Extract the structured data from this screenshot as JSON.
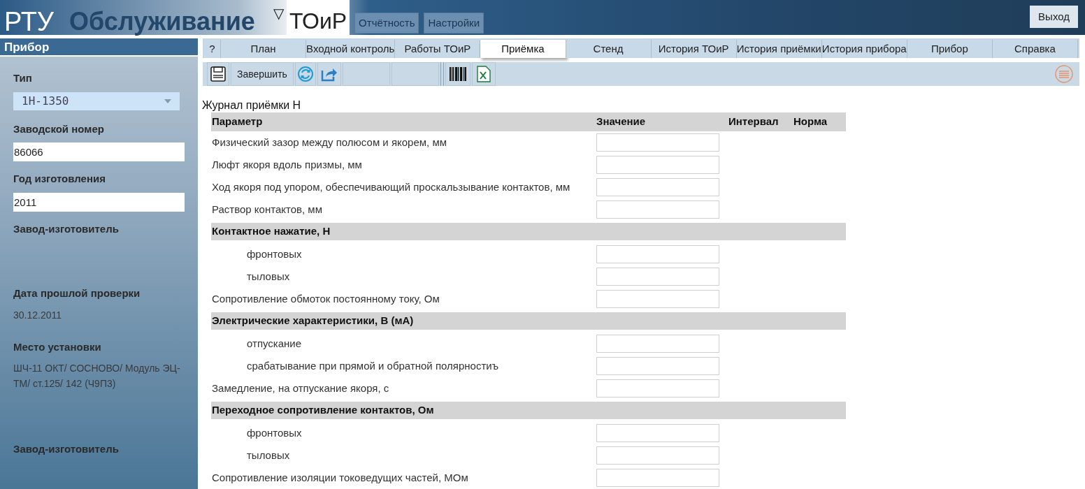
{
  "header": {
    "brand": "РТУ",
    "title": "Обслуживание",
    "module_caret": "▽",
    "module": "ТОиР",
    "menu": [
      {
        "label": "Отчётность"
      },
      {
        "label": "Настройки"
      }
    ],
    "logout": "Выход"
  },
  "sidebar": {
    "title": "Прибор",
    "fields": [
      {
        "kind": "select",
        "label": "Тип",
        "value": "1Н-1350"
      },
      {
        "kind": "input",
        "label": "Заводской номер",
        "value": "86066"
      },
      {
        "kind": "input",
        "label": "Год изготовления",
        "value": "2011"
      },
      {
        "kind": "text",
        "label": "Завод-изготовитель"
      },
      {
        "kind": "text",
        "label": "Дата прошлой проверки",
        "value": "30.12.2011"
      },
      {
        "kind": "text",
        "label": "Место установки",
        "value": "ШЧ-11 ОКТ/ СОСНОВО/ Модуль ЭЦ-ТМ/ ст.125/ 142 (Ч9П3)"
      },
      {
        "kind": "text",
        "label": "Завод-изготовитель"
      }
    ]
  },
  "tabs": [
    {
      "label": "?",
      "selected": false
    },
    {
      "label": "План",
      "selected": false
    },
    {
      "label": "Входной контроль",
      "selected": false
    },
    {
      "label": "Работы ТОиР",
      "selected": false
    },
    {
      "label": "Приёмка",
      "selected": true
    },
    {
      "label": "Стенд",
      "selected": false
    },
    {
      "label": "История ТОиР",
      "selected": false
    },
    {
      "label": "История приёмки",
      "selected": false
    },
    {
      "label": "История прибора",
      "selected": false
    },
    {
      "label": "Прибор",
      "selected": false
    },
    {
      "label": "Справка",
      "selected": false
    }
  ],
  "toolbar": [
    {
      "kind": "save"
    },
    {
      "kind": "button",
      "label": "Завершить",
      "disabled": false
    },
    {
      "kind": "refresh"
    },
    {
      "kind": "share"
    },
    {
      "kind": "button",
      "disabled": true
    },
    {
      "kind": "button",
      "disabled": true
    },
    {
      "kind": "separator"
    },
    {
      "kind": "barcode"
    },
    {
      "kind": "excel"
    }
  ],
  "journal": {
    "title": "Журнал приёмки Н",
    "columns": [
      "Параметр",
      "Значение",
      "Интервал",
      "Норма"
    ],
    "rows": [
      {
        "kind": "param",
        "label": "Физический зазор между полюсом и якорем, мм"
      },
      {
        "kind": "param",
        "label": "Люфт якоря вдоль призмы, мм"
      },
      {
        "kind": "param",
        "label": "Ход якоря под упором, обеспечивающий проскальзывание контактов, мм"
      },
      {
        "kind": "param",
        "label": "Раствор контактов, мм"
      },
      {
        "kind": "group",
        "label": "Контактное нажатие, Н"
      },
      {
        "kind": "sub",
        "label": "фронтовых"
      },
      {
        "kind": "sub",
        "label": "тыловых"
      },
      {
        "kind": "param",
        "label": "Сопротивление обмоток постоянному току, Ом"
      },
      {
        "kind": "group",
        "label": "Электрические характеристики, В (мА)"
      },
      {
        "kind": "sub",
        "label": "отпускание"
      },
      {
        "kind": "sub",
        "label": "срабатывание при прямой и обратной полярностиъ"
      },
      {
        "kind": "param",
        "label": "Замедление, на отпускание якоря, с"
      },
      {
        "kind": "group",
        "label": "Переходное сопротивление контактов, Ом"
      },
      {
        "kind": "sub",
        "label": "фронтовых"
      },
      {
        "kind": "sub",
        "label": "тыловых"
      },
      {
        "kind": "param",
        "label": "Сопротивление изоляции токоведущих частей, МОм"
      }
    ]
  }
}
